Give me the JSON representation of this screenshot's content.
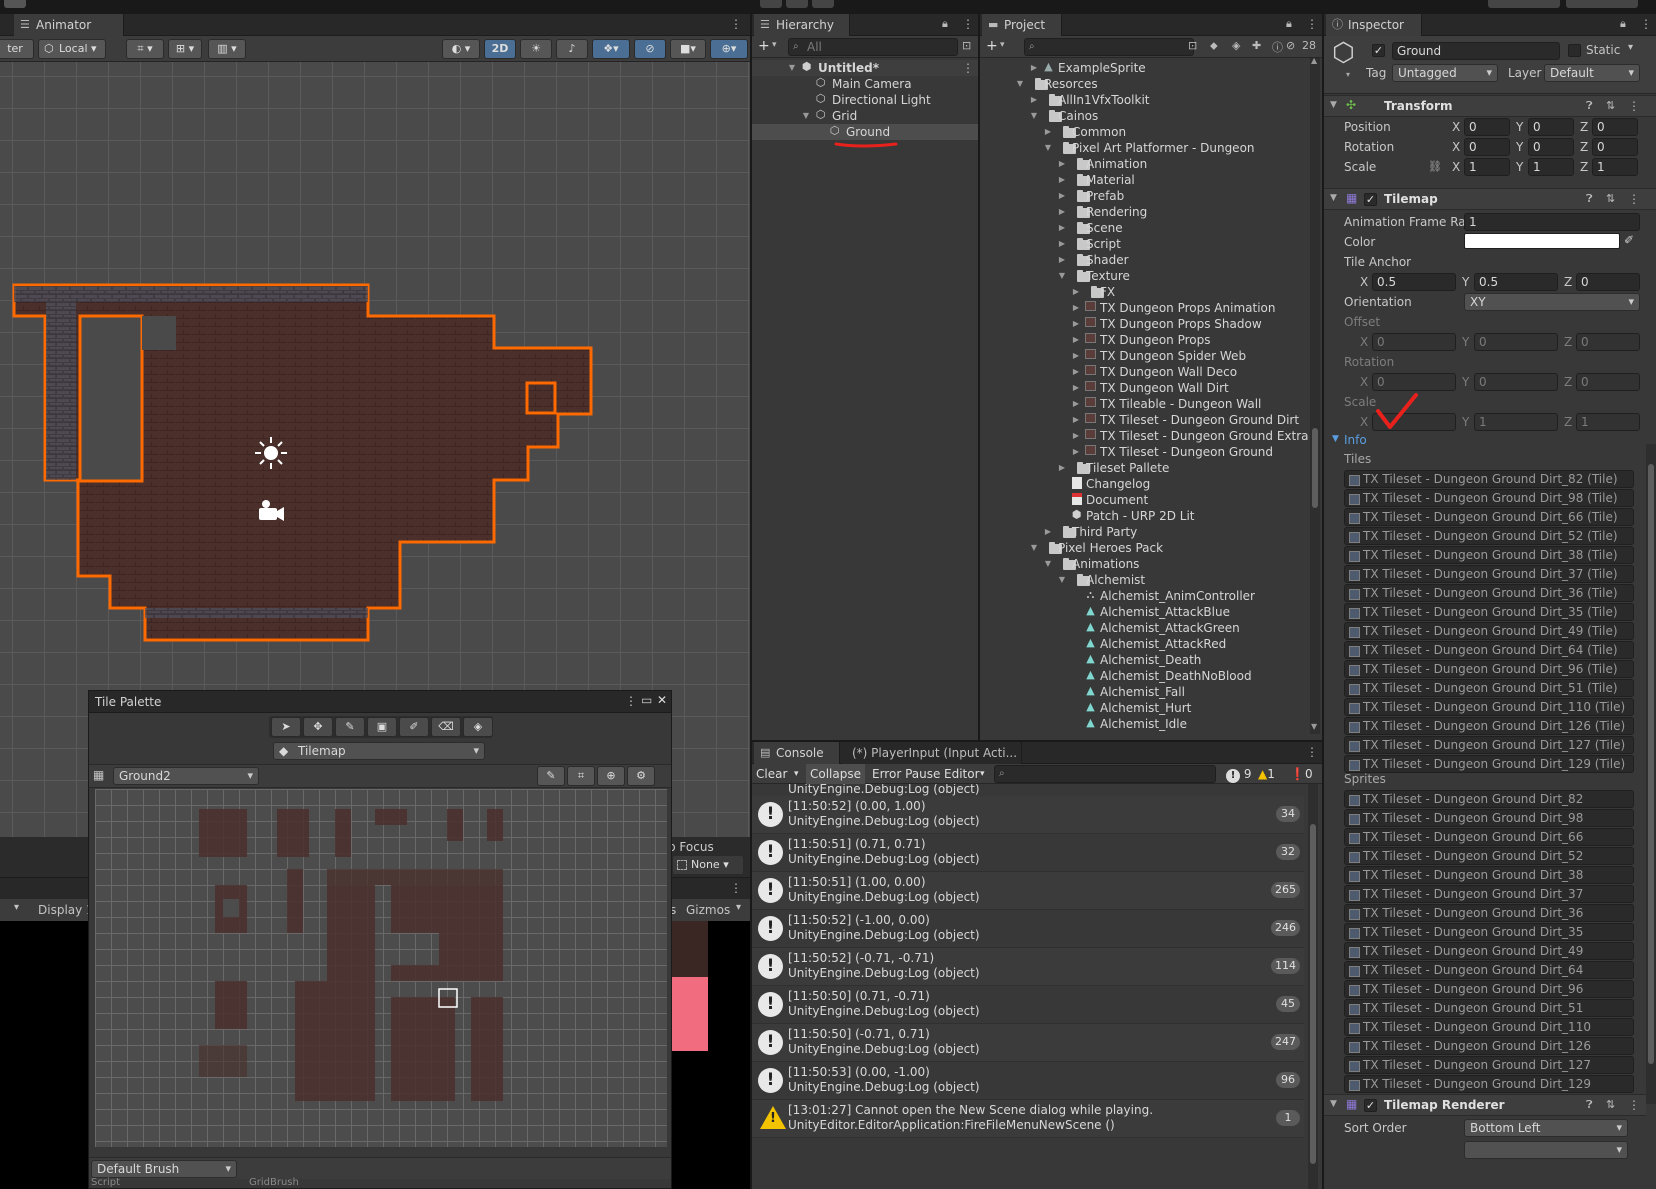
{
  "colors": {
    "accent_selection": "#2c5d87",
    "tilemap_outline": "#ff6a00",
    "annotation_red": "#e8211c",
    "brick": "#4a2f2b"
  },
  "animator": {
    "tab_label": "Animator",
    "toolbar": {
      "pivot_label": "ter",
      "local_label": "Local",
      "mode_2d": "2D"
    }
  },
  "scene_partial": {
    "focus_label": "p Focus",
    "none_label": "None",
    "display_label": "Display 1",
    "s_label": "s",
    "gizmos_label": "Gizmos"
  },
  "tile_palette": {
    "title": "Tile Palette",
    "target_label": "Tilemap",
    "palette_label": "Ground2",
    "brush_label": "Default Brush",
    "footer_left": "Script",
    "footer_right": "GridBrush"
  },
  "hierarchy": {
    "tab_label": "Hierarchy",
    "search_placeholder": "All",
    "scene_name": "Untitled*",
    "items": [
      {
        "label": "Main Camera"
      },
      {
        "label": "Directional Light"
      },
      {
        "label": "Grid"
      },
      {
        "label": "Ground"
      }
    ]
  },
  "project": {
    "tab_label": "Project",
    "item_count": "28",
    "items": [
      {
        "label": "ExampleSprite",
        "depth": 1,
        "icon": "sprite",
        "arrow": "right"
      },
      {
        "label": "Resorces",
        "depth": 0,
        "icon": "folder",
        "arrow": "down"
      },
      {
        "label": "AllIn1VfxToolkit",
        "depth": 1,
        "icon": "folder",
        "arrow": "right"
      },
      {
        "label": "Cainos",
        "depth": 1,
        "icon": "folder",
        "arrow": "down"
      },
      {
        "label": "Common",
        "depth": 2,
        "icon": "folder",
        "arrow": "right"
      },
      {
        "label": "Pixel Art Platformer - Dungeon",
        "depth": 2,
        "icon": "folder",
        "arrow": "down"
      },
      {
        "label": "Animation",
        "depth": 3,
        "icon": "folder",
        "arrow": "right"
      },
      {
        "label": "Material",
        "depth": 3,
        "icon": "folder",
        "arrow": "right"
      },
      {
        "label": "Prefab",
        "depth": 3,
        "icon": "folder",
        "arrow": "right"
      },
      {
        "label": "Rendering",
        "depth": 3,
        "icon": "folder",
        "arrow": "right"
      },
      {
        "label": "Scene",
        "depth": 3,
        "icon": "folder",
        "arrow": "right"
      },
      {
        "label": "Script",
        "depth": 3,
        "icon": "folder",
        "arrow": "right"
      },
      {
        "label": "Shader",
        "depth": 3,
        "icon": "folder",
        "arrow": "right"
      },
      {
        "label": "Texture",
        "depth": 3,
        "icon": "folder",
        "arrow": "down"
      },
      {
        "label": "FX",
        "depth": 4,
        "icon": "folder",
        "arrow": "right"
      },
      {
        "label": "TX Dungeon Props Animation",
        "depth": 4,
        "icon": "texture",
        "arrow": "right"
      },
      {
        "label": "TX Dungeon Props Shadow",
        "depth": 4,
        "icon": "texture",
        "arrow": "right"
      },
      {
        "label": "TX Dungeon Props",
        "depth": 4,
        "icon": "texture",
        "arrow": "right"
      },
      {
        "label": "TX Dungeon Spider Web",
        "depth": 4,
        "icon": "texture",
        "arrow": "right"
      },
      {
        "label": "TX Dungeon Wall Deco",
        "depth": 4,
        "icon": "texture",
        "arrow": "right"
      },
      {
        "label": "TX Dungeon Wall Dirt",
        "depth": 4,
        "icon": "texture",
        "arrow": "right"
      },
      {
        "label": "TX Tileable - Dungeon Wall",
        "depth": 4,
        "icon": "texture",
        "arrow": "right"
      },
      {
        "label": "TX Tileset - Dungeon Ground Dirt",
        "depth": 4,
        "icon": "texture",
        "arrow": "right"
      },
      {
        "label": "TX Tileset - Dungeon Ground Extra",
        "depth": 4,
        "icon": "texture",
        "arrow": "right"
      },
      {
        "label": "TX Tileset - Dungeon Ground",
        "depth": 4,
        "icon": "texture",
        "arrow": "right"
      },
      {
        "label": "Tileset Pallete",
        "depth": 3,
        "icon": "folder",
        "arrow": "right"
      },
      {
        "label": "Changelog",
        "depth": 3,
        "icon": "doc",
        "arrow": ""
      },
      {
        "label": "Document",
        "depth": 3,
        "icon": "pdf",
        "arrow": ""
      },
      {
        "label": "Patch - URP 2D Lit",
        "depth": 3,
        "icon": "package",
        "arrow": ""
      },
      {
        "label": "Third Party",
        "depth": 2,
        "icon": "folder",
        "arrow": "right"
      },
      {
        "label": "Pixel Heroes Pack",
        "depth": 1,
        "icon": "folder",
        "arrow": "down"
      },
      {
        "label": "Animations",
        "depth": 2,
        "icon": "folder",
        "arrow": "down"
      },
      {
        "label": "Alchemist",
        "depth": 3,
        "icon": "folder",
        "arrow": "down"
      },
      {
        "label": "Alchemist_AnimController",
        "depth": 4,
        "icon": "anim",
        "arrow": ""
      },
      {
        "label": "Alchemist_AttackBlue",
        "depth": 4,
        "icon": "clip",
        "arrow": ""
      },
      {
        "label": "Alchemist_AttackGreen",
        "depth": 4,
        "icon": "clip",
        "arrow": ""
      },
      {
        "label": "Alchemist_AttackRed",
        "depth": 4,
        "icon": "clip",
        "arrow": ""
      },
      {
        "label": "Alchemist_Death",
        "depth": 4,
        "icon": "clip",
        "arrow": ""
      },
      {
        "label": "Alchemist_DeathNoBlood",
        "depth": 4,
        "icon": "clip",
        "arrow": ""
      },
      {
        "label": "Alchemist_Fall",
        "depth": 4,
        "icon": "clip",
        "arrow": ""
      },
      {
        "label": "Alchemist_Hurt",
        "depth": 4,
        "icon": "clip",
        "arrow": ""
      },
      {
        "label": "Alchemist_Idle",
        "depth": 4,
        "icon": "clip",
        "arrow": ""
      }
    ]
  },
  "console": {
    "tab_label": "Console",
    "tab2_label": "(*) PlayerInput (Input Acti...",
    "clear": "Clear",
    "collapse": "Collapse",
    "error_pause": "Error Pause",
    "editor": "Editor",
    "log_count": "9",
    "warn_count": "1",
    "error_count": "0",
    "partial_top": "UnityEngine.Debug:Log (object)",
    "entries": [
      {
        "line1": "[11:50:52] (0.00, 1.00)",
        "line2": "UnityEngine.Debug:Log (object)",
        "count": "34",
        "type": "log"
      },
      {
        "line1": "[11:50:51] (0.71, 0.71)",
        "line2": "UnityEngine.Debug:Log (object)",
        "count": "32",
        "type": "log"
      },
      {
        "line1": "[11:50:51] (1.00, 0.00)",
        "line2": "UnityEngine.Debug:Log (object)",
        "count": "265",
        "type": "log"
      },
      {
        "line1": "[11:50:52] (-1.00, 0.00)",
        "line2": "UnityEngine.Debug:Log (object)",
        "count": "246",
        "type": "log"
      },
      {
        "line1": "[11:50:52] (-0.71, -0.71)",
        "line2": "UnityEngine.Debug:Log (object)",
        "count": "114",
        "type": "log"
      },
      {
        "line1": "[11:50:50] (0.71, -0.71)",
        "line2": "UnityEngine.Debug:Log (object)",
        "count": "45",
        "type": "log"
      },
      {
        "line1": "[11:50:50] (-0.71, 0.71)",
        "line2": "UnityEngine.Debug:Log (object)",
        "count": "247",
        "type": "log"
      },
      {
        "line1": "[11:50:53] (0.00, -1.00)",
        "line2": "UnityEngine.Debug:Log (object)",
        "count": "96",
        "type": "log"
      },
      {
        "line1": "[13:01:27] Cannot open the New Scene dialog while playing.",
        "line2": "UnityEditor.EditorApplication:FireFileMenuNewScene ()",
        "count": "1",
        "type": "warn"
      }
    ]
  },
  "inspector": {
    "tab_label": "Inspector",
    "object_name": "Ground",
    "static_label": "Static",
    "tag_label": "Tag",
    "tag_value": "Untagged",
    "layer_label": "Layer",
    "layer_value": "Default",
    "transform": {
      "title": "Transform",
      "position_label": "Position",
      "rotation_label": "Rotation",
      "scale_label": "Scale",
      "x": "X",
      "y": "Y",
      "z": "Z",
      "position": [
        "0",
        "0",
        "0"
      ],
      "rotation": [
        "0",
        "0",
        "0"
      ],
      "scale": [
        "1",
        "1",
        "1"
      ]
    },
    "tilemap": {
      "title": "Tilemap",
      "frame_rate_label": "Animation Frame Rate",
      "frame_rate": "1",
      "color_label": "Color",
      "color_value": "#ffffff",
      "anchor_label": "Tile Anchor",
      "anchor": [
        "0.5",
        "0.5",
        "0"
      ],
      "orientation_label": "Orientation",
      "orientation": "XY",
      "offset_label": "Offset",
      "offset": [
        "0",
        "0",
        "0"
      ],
      "rotation_label": "Rotation",
      "rotation": [
        "0",
        "0",
        "0"
      ],
      "scale_label": "Scale",
      "scale": [
        "1",
        "1",
        "1"
      ],
      "info_label": "Info",
      "tiles_label": "Tiles",
      "tiles": [
        "TX Tileset - Dungeon Ground Dirt_82 (Tile)",
        "TX Tileset - Dungeon Ground Dirt_98 (Tile)",
        "TX Tileset - Dungeon Ground Dirt_66 (Tile)",
        "TX Tileset - Dungeon Ground Dirt_52 (Tile)",
        "TX Tileset - Dungeon Ground Dirt_38 (Tile)",
        "TX Tileset - Dungeon Ground Dirt_37 (Tile)",
        "TX Tileset - Dungeon Ground Dirt_36 (Tile)",
        "TX Tileset - Dungeon Ground Dirt_35 (Tile)",
        "TX Tileset - Dungeon Ground Dirt_49 (Tile)",
        "TX Tileset - Dungeon Ground Dirt_64 (Tile)",
        "TX Tileset - Dungeon Ground Dirt_96 (Tile)",
        "TX Tileset - Dungeon Ground Dirt_51 (Tile)",
        "TX Tileset - Dungeon Ground Dirt_110 (Tile)",
        "TX Tileset - Dungeon Ground Dirt_126 (Tile)",
        "TX Tileset - Dungeon Ground Dirt_127 (Tile)",
        "TX Tileset - Dungeon Ground Dirt_129 (Tile)"
      ],
      "sprites_label": "Sprites",
      "sprites": [
        "TX Tileset - Dungeon Ground Dirt_82",
        "TX Tileset - Dungeon Ground Dirt_98",
        "TX Tileset - Dungeon Ground Dirt_66",
        "TX Tileset - Dungeon Ground Dirt_52",
        "TX Tileset - Dungeon Ground Dirt_38",
        "TX Tileset - Dungeon Ground Dirt_37",
        "TX Tileset - Dungeon Ground Dirt_36",
        "TX Tileset - Dungeon Ground Dirt_35",
        "TX Tileset - Dungeon Ground Dirt_49",
        "TX Tileset - Dungeon Ground Dirt_64",
        "TX Tileset - Dungeon Ground Dirt_96",
        "TX Tileset - Dungeon Ground Dirt_51",
        "TX Tileset - Dungeon Ground Dirt_110",
        "TX Tileset - Dungeon Ground Dirt_126",
        "TX Tileset - Dungeon Ground Dirt_127",
        "TX Tileset - Dungeon Ground Dirt_129"
      ]
    },
    "renderer": {
      "title": "Tilemap Renderer",
      "sort_order_label": "Sort Order",
      "sort_order": "Bottom Left"
    }
  }
}
